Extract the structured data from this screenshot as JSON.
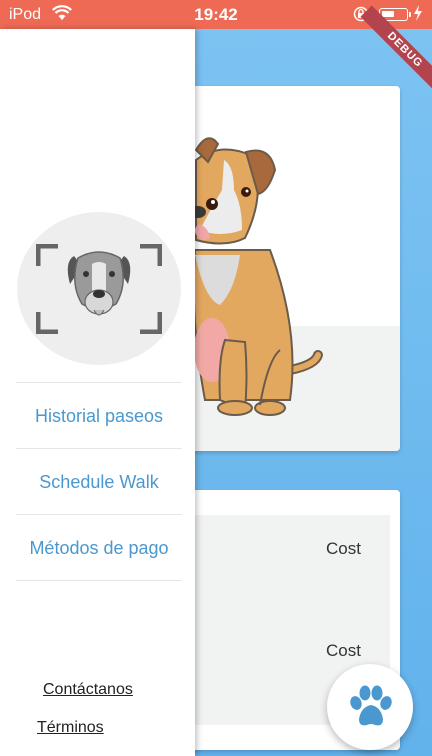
{
  "status_bar": {
    "carrier": "iPod",
    "time": "19:42",
    "icons": [
      "wifi-icon",
      "orientation-lock-icon",
      "battery-icon",
      "charging-bolt-icon"
    ]
  },
  "debug_banner": "DEBUG",
  "drawer": {
    "menu": [
      {
        "label": "Historial paseos"
      },
      {
        "label": "Schedule Walk"
      },
      {
        "label": "Métodos de pago"
      }
    ],
    "footer": {
      "contact": "Contáctanos",
      "terms": "Términos"
    }
  },
  "walk_card": {
    "cost_labels": [
      "Cost",
      "Cost"
    ]
  },
  "fab_icon": "paw-icon",
  "colors": {
    "status_bar": "#ee6a55",
    "background": "#6cb8ee",
    "menu_text": "#4a98cf"
  }
}
